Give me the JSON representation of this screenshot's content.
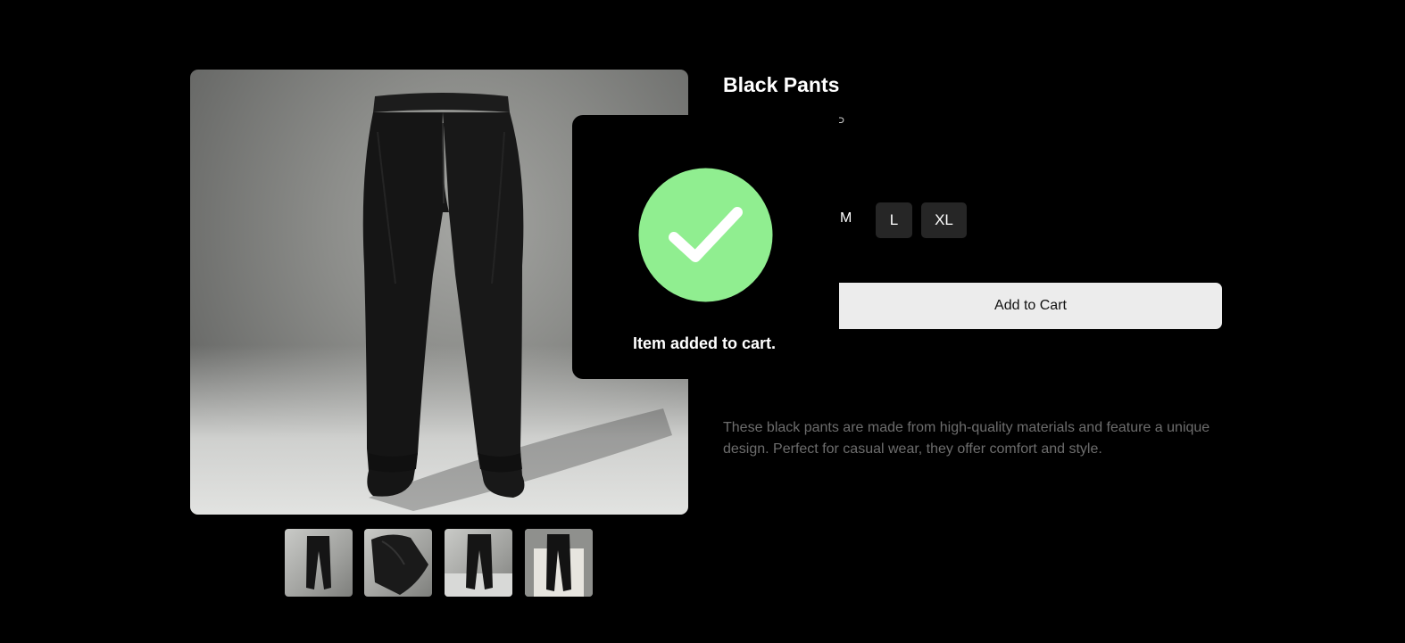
{
  "product": {
    "title": "Black Pants",
    "price_glyph": "⊃",
    "description": "These black pants are made from high-quality materials and feature a unique design. Perfect for casual wear, they offer comfort and style."
  },
  "gallery": {
    "main_image_icon": "black-pants-photo",
    "thumbnails": [
      {
        "icon": "pants-front-photo"
      },
      {
        "icon": "pants-folded-photo"
      },
      {
        "icon": "pants-standing-photo"
      },
      {
        "icon": "pants-studio-photo"
      }
    ]
  },
  "sizes": {
    "options": [
      "M",
      "L",
      "XL"
    ]
  },
  "cart": {
    "add_label": "Add to Cart"
  },
  "toast": {
    "message": "Item added to cart.",
    "icon": "checkmark-icon",
    "accent": "#90ee90"
  },
  "colors": {
    "background": "#000000",
    "button_bg": "#ececec",
    "size_bg": "#262626",
    "description_text": "#6d6d6d"
  }
}
